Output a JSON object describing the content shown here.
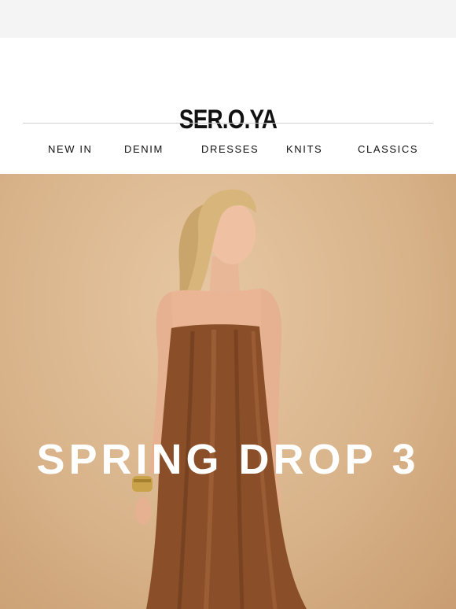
{
  "brand": {
    "logo_text": "SER.O.YA"
  },
  "nav": {
    "items": [
      {
        "label": "NEW IN"
      },
      {
        "label": "DENIM"
      },
      {
        "label": "DRESSES"
      },
      {
        "label": "KNITS"
      },
      {
        "label": "CLASSICS"
      }
    ]
  },
  "hero": {
    "headline": "SPRING DROP 3",
    "colors": {
      "backdrop": "#d9b48b",
      "dress": "#8a4f29",
      "headline": "#ffffff"
    }
  }
}
